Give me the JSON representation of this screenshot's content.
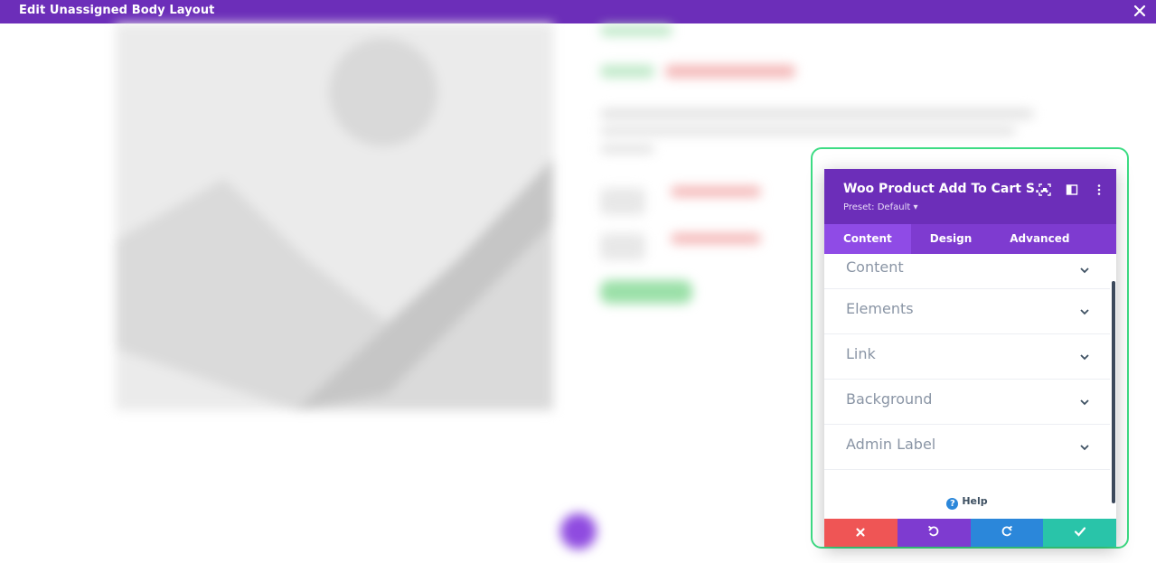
{
  "topbar": {
    "title": "Edit Unassigned Body Layout",
    "close_icon": "close-icon"
  },
  "modal": {
    "title": "Woo Product Add To Cart S...",
    "preset": "Preset: Default ▾",
    "header_icons": [
      "expand-icon",
      "split-view-icon",
      "more-vertical-icon"
    ],
    "tabs": [
      {
        "label": "Content",
        "active": true
      },
      {
        "label": "Design",
        "active": false
      },
      {
        "label": "Advanced",
        "active": false
      }
    ],
    "sections": [
      {
        "label": "Content"
      },
      {
        "label": "Elements"
      },
      {
        "label": "Link"
      },
      {
        "label": "Background"
      },
      {
        "label": "Admin Label"
      }
    ],
    "help_label": "Help",
    "footer": [
      {
        "icon": "discard-icon",
        "color": "#ef5555"
      },
      {
        "icon": "undo-icon",
        "color": "#7e3bd0"
      },
      {
        "icon": "redo-icon",
        "color": "#2b87da"
      },
      {
        "icon": "save-check-icon",
        "color": "#29c4a9"
      }
    ]
  },
  "colors": {
    "accent": "#6c2eb9",
    "outline": "#3ddc84"
  }
}
